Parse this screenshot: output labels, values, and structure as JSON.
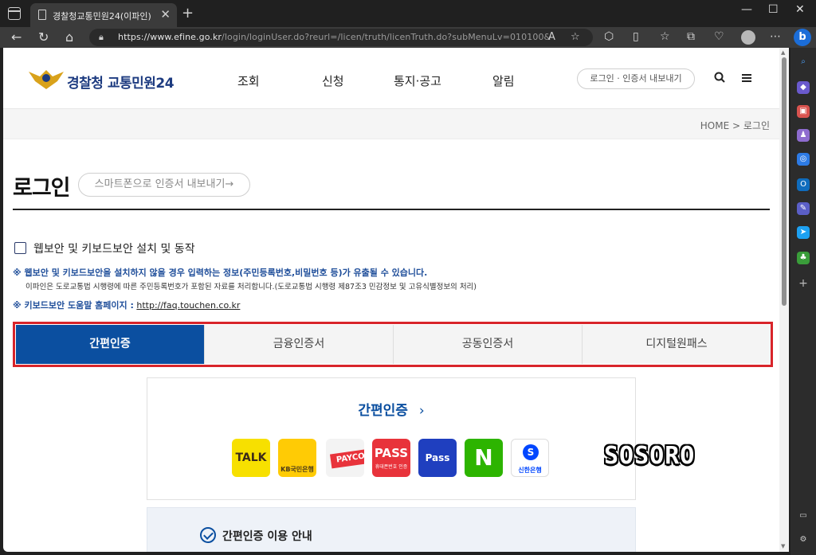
{
  "browser": {
    "tab_title": "경찰청교통민원24(이파인)",
    "new_tab_symbol": "+",
    "close_symbol": "✕",
    "url_host": "https://www.efine.go.kr",
    "url_path": "/login/loginUser.do?reurl=/licen/truth/licenTruth.do?subMenuLv=010100&",
    "window_controls": [
      "—",
      "☐",
      "✕"
    ],
    "nav_icons": [
      "back-icon",
      "refresh-icon",
      "home-icon"
    ],
    "toolbar_icons": [
      "read-aloud-icon",
      "favorite-icon",
      "extensions-icon",
      "split-screen-icon",
      "favorites-bar-icon",
      "collections-icon",
      "browser-essentials-icon",
      "profile-icon",
      "more-icon",
      "copilot-icon"
    ]
  },
  "header": {
    "logo_text": "경찰청 교통민원24",
    "nav": [
      "조회",
      "신청",
      "통지·공고",
      "알림"
    ],
    "login_pill": "로그인 · 인증서 내보내기"
  },
  "breadcrumb": "HOME > 로그인",
  "page": {
    "title": "로그인",
    "smart_button": "스마트폰으로 인증서 내보내기→",
    "checkbox_label": "웹보안 및 키보드보안 설치 및 동작",
    "notice_main": "※ 웹보안 및 키보드보안을 설치하지 않을 경우 입력하는 정보(주민등록번호,비밀번호 등)가 유출될 수 있습니다.",
    "notice_sub": "이파인은 도로교통법 시행령에 따른 주민등록번호가 포함된 자료를 처리합니다.(도로교통법 시행령 제87조3 민감정보 및 고유식별정보의 처리)",
    "help_label": "※ 키보드보안 도움말 홈페이지 :",
    "help_link": "http://faq.touchen.co.kr"
  },
  "auth_tabs": [
    {
      "label": "간편인증",
      "active": true
    },
    {
      "label": "금융인증서",
      "active": false
    },
    {
      "label": "공동인증서",
      "active": false
    },
    {
      "label": "디지털원패스",
      "active": false
    }
  ],
  "simple_auth": {
    "title": "간편인증",
    "chevron": "›",
    "apps": [
      {
        "name": "TALK",
        "icon": "kakao-talk-icon",
        "color": "#f7e000",
        "text_color": "#3b2a1a"
      },
      {
        "name": "KB국민은행",
        "icon": "kb-bank-icon",
        "color": "#ffcb05",
        "text_color": "#4a3a1a"
      },
      {
        "name": "PAYCO",
        "icon": "payco-icon",
        "color": "#f3f3f3",
        "text_color": "#ffffff"
      },
      {
        "name": "PASS",
        "icon": "pass-icon",
        "color": "#e8333b",
        "text_color": "#ffffff"
      },
      {
        "name": "Pass",
        "icon": "samsung-pass-icon",
        "color": "#1f3fbf",
        "text_color": "#ffffff"
      },
      {
        "name": "N",
        "icon": "naver-icon",
        "color": "#2db400",
        "text_color": "#ffffff"
      },
      {
        "name": "신한은행",
        "icon": "shinhan-bank-icon",
        "color": "#ffffff",
        "text_color": "#0046ff"
      }
    ],
    "pass_subtext": "휴대폰번호 인증",
    "guide_title": "간편인증 이용 안내"
  },
  "watermark": "SOSORO"
}
